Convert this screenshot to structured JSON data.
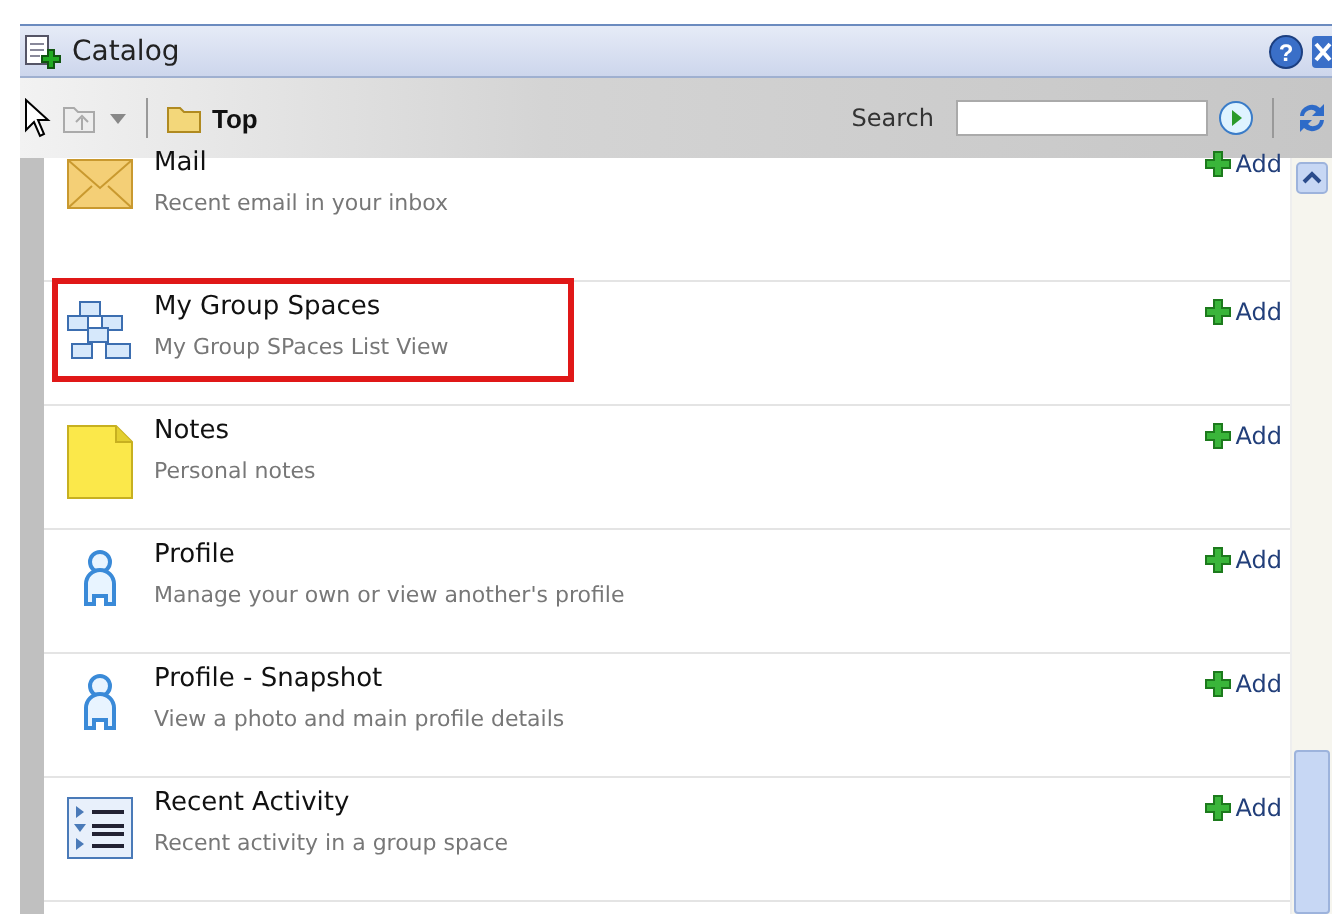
{
  "window": {
    "title": "Catalog",
    "help": "?"
  },
  "toolbar": {
    "breadcrumb": "Top",
    "search_label": "Search"
  },
  "items": [
    {
      "kind": "mail",
      "name": "Mail",
      "description": "Recent email in your inbox",
      "action": "Add",
      "highlighted": false
    },
    {
      "kind": "group",
      "name": "My Group Spaces",
      "description": "My Group SPaces List View",
      "action": "Add",
      "highlighted": true
    },
    {
      "kind": "note",
      "name": "Notes",
      "description": "Personal notes",
      "action": "Add",
      "highlighted": false
    },
    {
      "kind": "person",
      "name": "Profile",
      "description": "Manage your own or view another's profile",
      "action": "Add",
      "highlighted": false
    },
    {
      "kind": "person",
      "name": "Profile - Snapshot",
      "description": "View a photo and main profile details",
      "action": "Add",
      "highlighted": false
    },
    {
      "kind": "list",
      "name": "Recent Activity",
      "description": "Recent activity in a group space",
      "action": "Add",
      "highlighted": false
    }
  ]
}
